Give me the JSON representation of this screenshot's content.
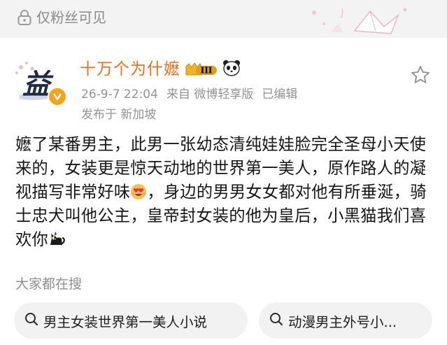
{
  "visibility": {
    "label": "仅粉丝可见",
    "icon": "lock-icon"
  },
  "author": {
    "name": "十万个为什嬷",
    "rank_badge": "III",
    "avatar_text": "益",
    "verified": true,
    "name_color": "#f26d18",
    "badge_color": "#f7a21c"
  },
  "post_meta": {
    "timestamp": "26-9-7 22:04",
    "source": "来自 微博轻享版",
    "edited": "已编辑",
    "location": "发布于 新加坡"
  },
  "post": {
    "text_part1": "嬷了某番男主，此男一张幼态清纯娃娃脸完全圣母小天使来的，女装更是惊天动地的世界第一美人，原作路人的凝视描写非常好味",
    "text_part2": "，身边的男男女女都对他有所垂涎，骑士忠犬叫他公主，皇帝封女装的他为皇后，小黑猫我们喜欢你",
    "emoji_1": "heart-eyes-emoji",
    "emoji_2": "black-cat-emoji"
  },
  "search_suggestions": {
    "heading": "大家都在搜",
    "items": [
      {
        "label": "男主女装世界第一美人小说",
        "icon": "search-icon"
      },
      {
        "label": "动漫男主外号小...",
        "icon": "search-icon"
      }
    ]
  }
}
